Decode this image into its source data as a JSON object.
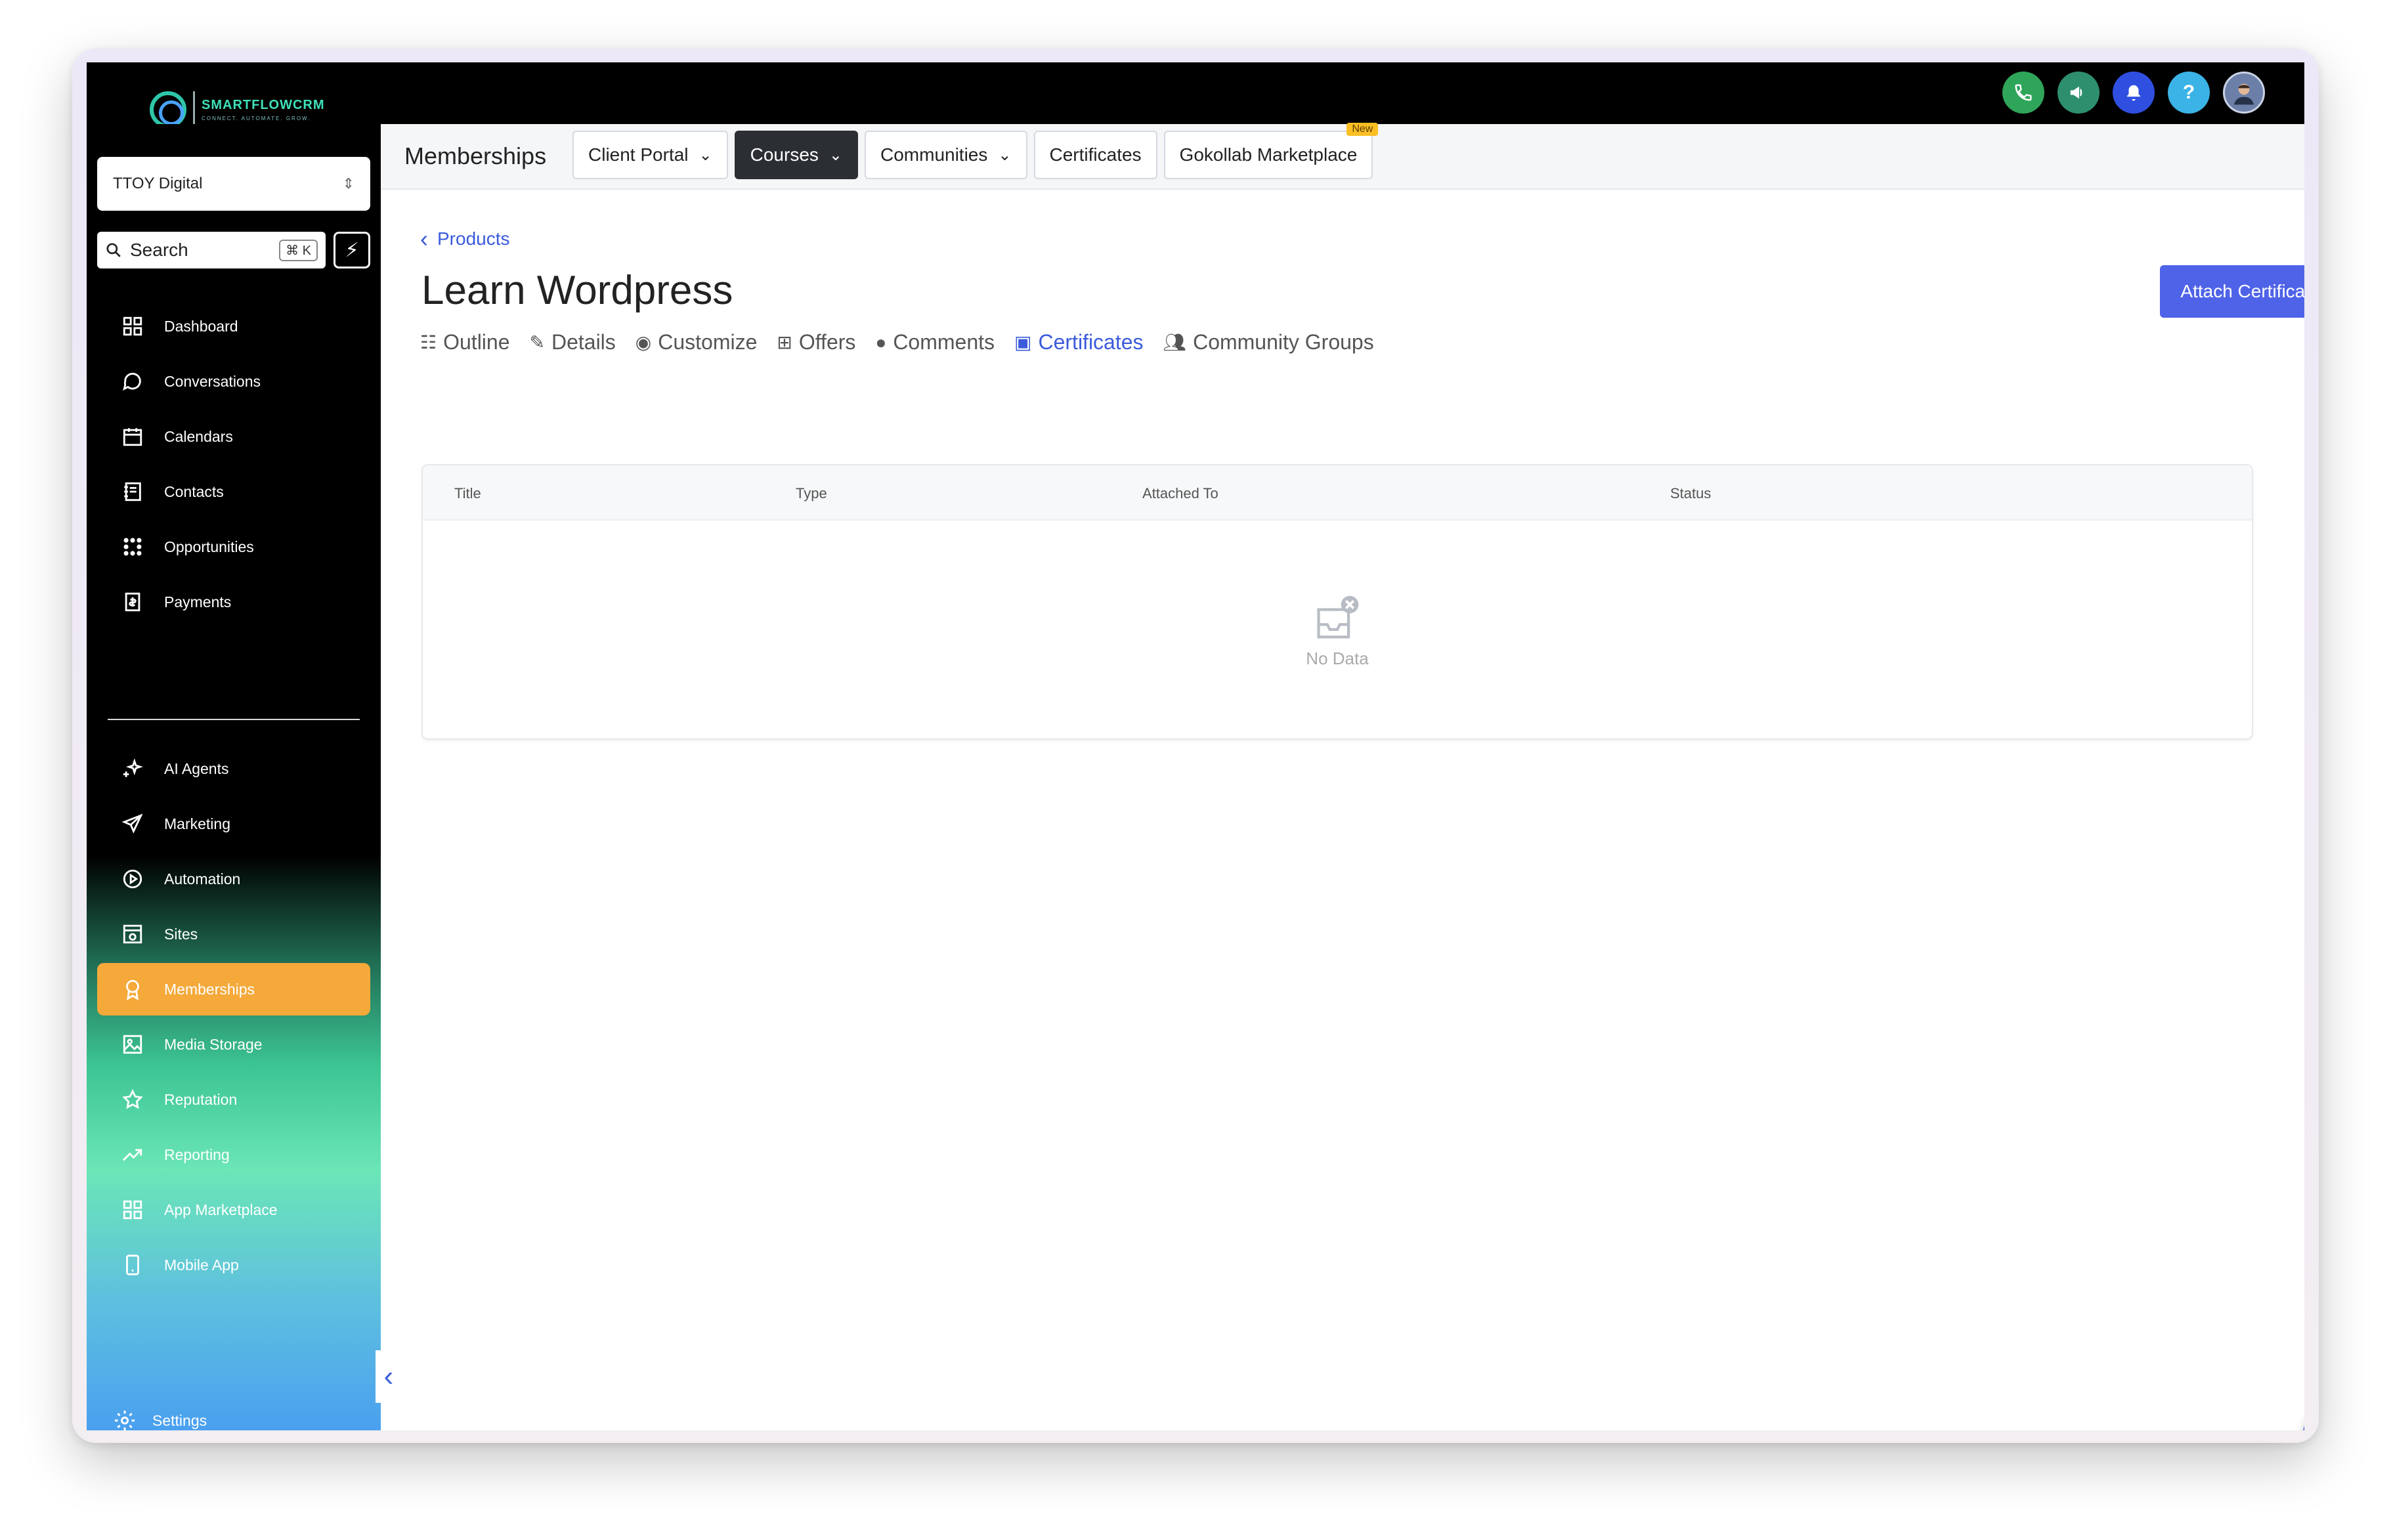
{
  "brand": {
    "name": "SMARTFLOWCRM",
    "tagline": "CONNECT. AUTOMATE. GROW."
  },
  "account": {
    "name": "TTOY Digital"
  },
  "search": {
    "label": "Search",
    "shortcut": "⌘ K"
  },
  "sidebar": {
    "items": [
      {
        "label": "Dashboard",
        "icon": "dashboard-icon"
      },
      {
        "label": "Conversations",
        "icon": "chat-icon"
      },
      {
        "label": "Calendars",
        "icon": "calendar-icon"
      },
      {
        "label": "Contacts",
        "icon": "contacts-icon"
      },
      {
        "label": "Opportunities",
        "icon": "opportunities-icon"
      },
      {
        "label": "Payments",
        "icon": "payments-icon"
      }
    ],
    "items2": [
      {
        "label": "AI Agents",
        "icon": "sparkle-icon"
      },
      {
        "label": "Marketing",
        "icon": "send-icon"
      },
      {
        "label": "Automation",
        "icon": "play-icon"
      },
      {
        "label": "Sites",
        "icon": "sites-icon"
      },
      {
        "label": "Memberships",
        "icon": "award-icon",
        "active": true
      },
      {
        "label": "Media Storage",
        "icon": "image-icon"
      },
      {
        "label": "Reputation",
        "icon": "star-icon"
      },
      {
        "label": "Reporting",
        "icon": "trend-icon"
      },
      {
        "label": "App Marketplace",
        "icon": "grid-icon"
      },
      {
        "label": "Mobile App",
        "icon": "mobile-icon"
      }
    ],
    "settings": "Settings"
  },
  "header": {
    "title": "Memberships",
    "tabs": {
      "client_portal": "Client Portal",
      "courses": "Courses",
      "communities": "Communities",
      "certificates": "Certificates",
      "marketplace": "Gokollab Marketplace",
      "new_badge": "New"
    }
  },
  "page": {
    "breadcrumb": "Products",
    "title": "Learn Wordpress",
    "attach_button": "Attach Certificate",
    "tabs": {
      "outline": "Outline",
      "details": "Details",
      "customize": "Customize",
      "offers": "Offers",
      "comments": "Comments",
      "certificates": "Certificates",
      "community_groups": "Community Groups"
    }
  },
  "table": {
    "columns": {
      "title": "Title",
      "type": "Type",
      "attached_to": "Attached To",
      "status": "Status"
    },
    "empty_text": "No Data"
  },
  "colors": {
    "accent": "#4f63e8",
    "active_nav": "#f4a93a",
    "link": "#3b5bdb"
  }
}
